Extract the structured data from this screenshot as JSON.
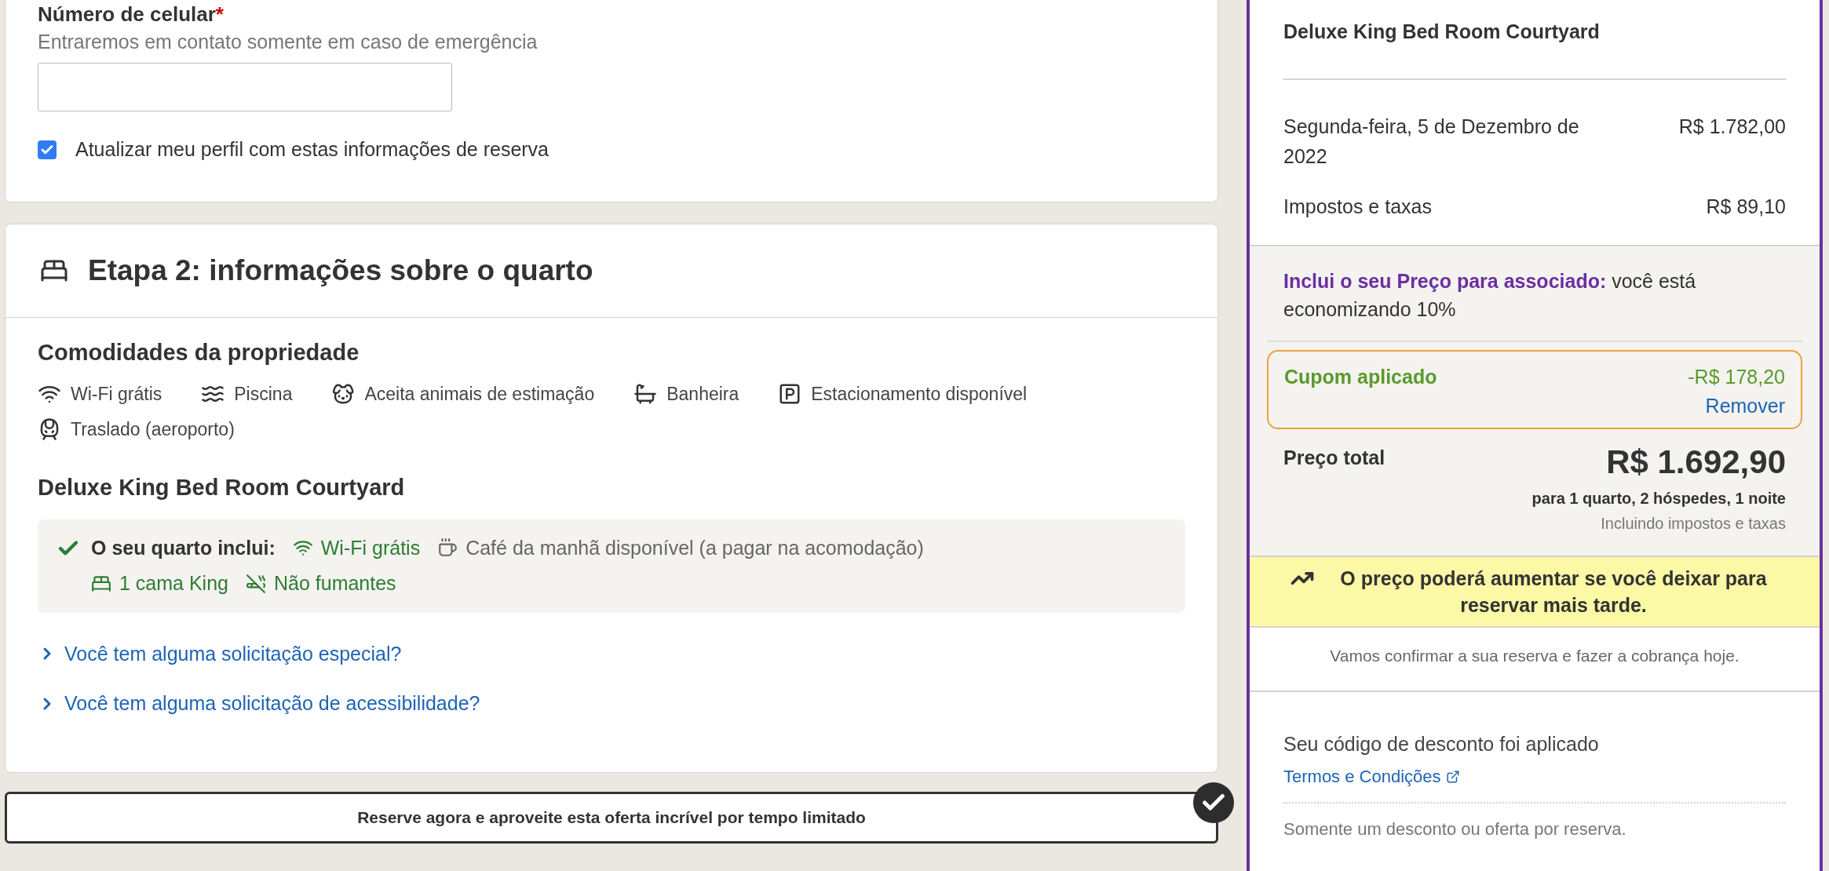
{
  "contact": {
    "label": "Número de celular",
    "required_mark": "*",
    "hint": "Entraremos em contato somente em caso de emergência",
    "update_profile": {
      "label": "Atualizar meu perfil com estas informações de reserva",
      "checked": true
    }
  },
  "room_step": {
    "title": "Etapa 2: informações sobre o quarto",
    "amenities_title": "Comodidades da propriedade",
    "amenities": [
      {
        "kind": "wifi",
        "label": "Wi-Fi grátis"
      },
      {
        "kind": "pool",
        "label": "Piscina"
      },
      {
        "kind": "pets",
        "label": "Aceita animais de estimação"
      },
      {
        "kind": "bath",
        "label": "Banheira"
      },
      {
        "kind": "parking",
        "label": "Estacionamento disponível"
      },
      {
        "kind": "shuttle",
        "label": "Traslado (aeroporto)"
      }
    ],
    "room_name": "Deluxe King Bed Room Courtyard",
    "includes_label": "O seu quarto inclui:",
    "includes": [
      {
        "kind": "wifi",
        "label": "Wi-Fi grátis",
        "included": true
      },
      {
        "kind": "coffee",
        "label": "Café da manhã disponível (a pagar na acomodação)",
        "included": false
      },
      {
        "kind": "bed",
        "label": "1 cama King",
        "included": true
      },
      {
        "kind": "nosmoking",
        "label": "Não fumantes",
        "included": true
      }
    ],
    "requests": [
      {
        "label": "Você tem alguma solicitação especial?",
        "expanded": false
      },
      {
        "label": "Você tem alguma solicitação de acessibilidade?",
        "expanded": false
      }
    ]
  },
  "offer_banner": "Reserve agora e aproveite esta oferta incrível por tempo limitado",
  "summary": {
    "room_name": "Deluxe King Bed Room Courtyard",
    "lines": [
      {
        "label": "Segunda-feira, 5 de Dezembro de 2022",
        "amount": "R$ 1.782,00"
      },
      {
        "label": "Impostos e taxas",
        "amount": "R$ 89,10"
      }
    ],
    "member_highlight": "Inclui o seu Preço para associado:",
    "member_text": " você está economizando 10%",
    "coupon": {
      "label": "Cupom aplicado",
      "amount": "-R$ 178,20",
      "remove": "Remover"
    },
    "total_label": "Preço total",
    "total": "R$ 1.692,90",
    "total_detail": "para 1 quarto, 2 hóspedes, 1 noite",
    "total_note": "Incluindo impostos e taxas",
    "warning": "O preço poderá aumentar se você deixar para reservar mais tarde.",
    "charge_note": "Vamos confirmar a sua reserva e fazer a cobrança hoje.",
    "discount_title": "Seu código de desconto foi aplicado",
    "terms_link": "Termos e Condições",
    "discount_note": "Somente um desconto ou oferta por reserva."
  }
}
